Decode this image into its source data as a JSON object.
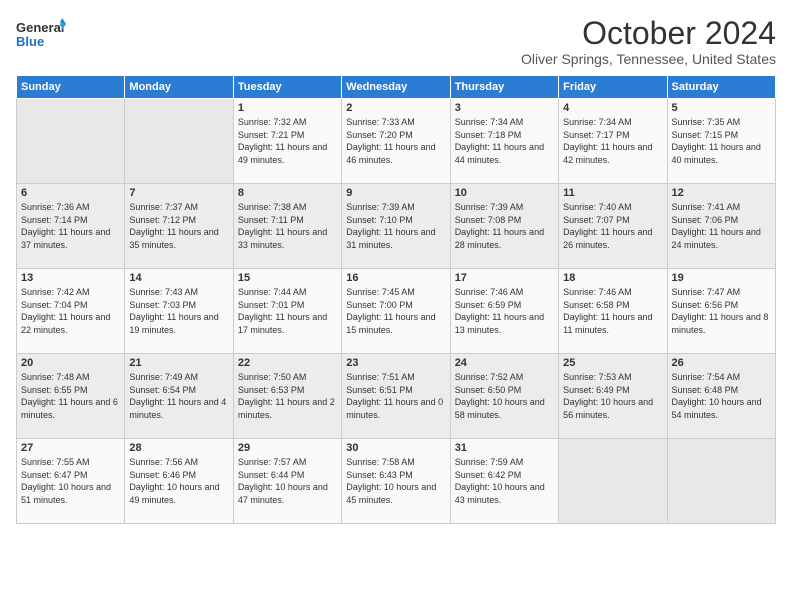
{
  "logo": {
    "line1": "General",
    "line2": "Blue"
  },
  "title": "October 2024",
  "location": "Oliver Springs, Tennessee, United States",
  "weekdays": [
    "Sunday",
    "Monday",
    "Tuesday",
    "Wednesday",
    "Thursday",
    "Friday",
    "Saturday"
  ],
  "weeks": [
    [
      {
        "day": "",
        "info": ""
      },
      {
        "day": "",
        "info": ""
      },
      {
        "day": "1",
        "info": "Sunrise: 7:32 AM\nSunset: 7:21 PM\nDaylight: 11 hours and 49 minutes."
      },
      {
        "day": "2",
        "info": "Sunrise: 7:33 AM\nSunset: 7:20 PM\nDaylight: 11 hours and 46 minutes."
      },
      {
        "day": "3",
        "info": "Sunrise: 7:34 AM\nSunset: 7:18 PM\nDaylight: 11 hours and 44 minutes."
      },
      {
        "day": "4",
        "info": "Sunrise: 7:34 AM\nSunset: 7:17 PM\nDaylight: 11 hours and 42 minutes."
      },
      {
        "day": "5",
        "info": "Sunrise: 7:35 AM\nSunset: 7:15 PM\nDaylight: 11 hours and 40 minutes."
      }
    ],
    [
      {
        "day": "6",
        "info": "Sunrise: 7:36 AM\nSunset: 7:14 PM\nDaylight: 11 hours and 37 minutes."
      },
      {
        "day": "7",
        "info": "Sunrise: 7:37 AM\nSunset: 7:12 PM\nDaylight: 11 hours and 35 minutes."
      },
      {
        "day": "8",
        "info": "Sunrise: 7:38 AM\nSunset: 7:11 PM\nDaylight: 11 hours and 33 minutes."
      },
      {
        "day": "9",
        "info": "Sunrise: 7:39 AM\nSunset: 7:10 PM\nDaylight: 11 hours and 31 minutes."
      },
      {
        "day": "10",
        "info": "Sunrise: 7:39 AM\nSunset: 7:08 PM\nDaylight: 11 hours and 28 minutes."
      },
      {
        "day": "11",
        "info": "Sunrise: 7:40 AM\nSunset: 7:07 PM\nDaylight: 11 hours and 26 minutes."
      },
      {
        "day": "12",
        "info": "Sunrise: 7:41 AM\nSunset: 7:06 PM\nDaylight: 11 hours and 24 minutes."
      }
    ],
    [
      {
        "day": "13",
        "info": "Sunrise: 7:42 AM\nSunset: 7:04 PM\nDaylight: 11 hours and 22 minutes."
      },
      {
        "day": "14",
        "info": "Sunrise: 7:43 AM\nSunset: 7:03 PM\nDaylight: 11 hours and 19 minutes."
      },
      {
        "day": "15",
        "info": "Sunrise: 7:44 AM\nSunset: 7:01 PM\nDaylight: 11 hours and 17 minutes."
      },
      {
        "day": "16",
        "info": "Sunrise: 7:45 AM\nSunset: 7:00 PM\nDaylight: 11 hours and 15 minutes."
      },
      {
        "day": "17",
        "info": "Sunrise: 7:46 AM\nSunset: 6:59 PM\nDaylight: 11 hours and 13 minutes."
      },
      {
        "day": "18",
        "info": "Sunrise: 7:46 AM\nSunset: 6:58 PM\nDaylight: 11 hours and 11 minutes."
      },
      {
        "day": "19",
        "info": "Sunrise: 7:47 AM\nSunset: 6:56 PM\nDaylight: 11 hours and 8 minutes."
      }
    ],
    [
      {
        "day": "20",
        "info": "Sunrise: 7:48 AM\nSunset: 6:55 PM\nDaylight: 11 hours and 6 minutes."
      },
      {
        "day": "21",
        "info": "Sunrise: 7:49 AM\nSunset: 6:54 PM\nDaylight: 11 hours and 4 minutes."
      },
      {
        "day": "22",
        "info": "Sunrise: 7:50 AM\nSunset: 6:53 PM\nDaylight: 11 hours and 2 minutes."
      },
      {
        "day": "23",
        "info": "Sunrise: 7:51 AM\nSunset: 6:51 PM\nDaylight: 11 hours and 0 minutes."
      },
      {
        "day": "24",
        "info": "Sunrise: 7:52 AM\nSunset: 6:50 PM\nDaylight: 10 hours and 58 minutes."
      },
      {
        "day": "25",
        "info": "Sunrise: 7:53 AM\nSunset: 6:49 PM\nDaylight: 10 hours and 56 minutes."
      },
      {
        "day": "26",
        "info": "Sunrise: 7:54 AM\nSunset: 6:48 PM\nDaylight: 10 hours and 54 minutes."
      }
    ],
    [
      {
        "day": "27",
        "info": "Sunrise: 7:55 AM\nSunset: 6:47 PM\nDaylight: 10 hours and 51 minutes."
      },
      {
        "day": "28",
        "info": "Sunrise: 7:56 AM\nSunset: 6:46 PM\nDaylight: 10 hours and 49 minutes."
      },
      {
        "day": "29",
        "info": "Sunrise: 7:57 AM\nSunset: 6:44 PM\nDaylight: 10 hours and 47 minutes."
      },
      {
        "day": "30",
        "info": "Sunrise: 7:58 AM\nSunset: 6:43 PM\nDaylight: 10 hours and 45 minutes."
      },
      {
        "day": "31",
        "info": "Sunrise: 7:59 AM\nSunset: 6:42 PM\nDaylight: 10 hours and 43 minutes."
      },
      {
        "day": "",
        "info": ""
      },
      {
        "day": "",
        "info": ""
      }
    ]
  ]
}
